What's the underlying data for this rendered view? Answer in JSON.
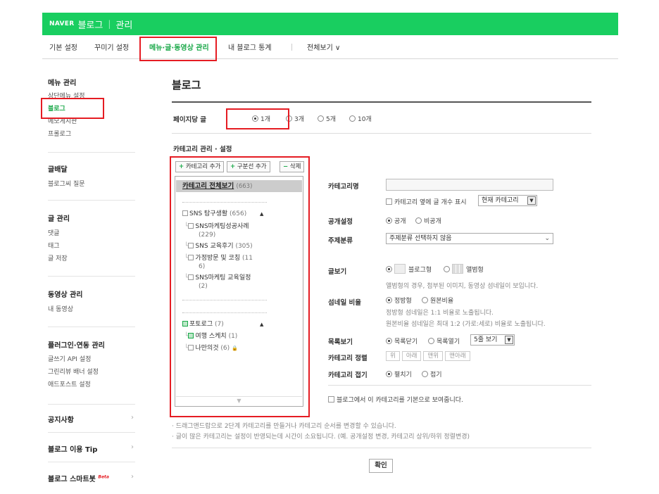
{
  "header": {
    "logo": "NAVER",
    "title": "블로그",
    "sep": "|",
    "section": "관리"
  },
  "nav": {
    "tabs": [
      "기본 설정",
      "꾸미기 설정",
      "메뉴·글·동영상 관리",
      "내 블로그 통계",
      "전체보기 ∨"
    ],
    "active": 2
  },
  "sidebar": {
    "sections": [
      {
        "title": "메뉴 관리",
        "items": [
          "상단메뉴 설정",
          "블로그",
          "메모게시판",
          "프롤로그"
        ]
      },
      {
        "title": "글배달",
        "items": [
          "블로그씨 질문"
        ]
      },
      {
        "title": "글 관리",
        "items": [
          "댓글",
          "태그",
          "글 저장"
        ]
      },
      {
        "title": "동영상 관리",
        "items": [
          "내 동영상"
        ]
      },
      {
        "title": "플러그인·연동 관리",
        "items": [
          "글쓰기 API 설정",
          "그린리뷰 배너 설정",
          "애드포스트 설정"
        ]
      }
    ],
    "links": [
      "공지사항",
      "블로그 이용 Tip",
      "블로그 스마트봇"
    ],
    "beta": "Beta",
    "arrow": "›"
  },
  "main": {
    "title": "블로그",
    "per_page": {
      "label": "페이지당 글",
      "options": [
        "1개",
        "3개",
        "5개",
        "10개"
      ],
      "selected": 0
    },
    "category_section_title": "카테고리 관리 · 설정",
    "buttons": {
      "add_category_icon": "+",
      "add_category": "카테고리 추가",
      "add_divider_icon": "+",
      "add_divider": "구분선 추가",
      "delete_icon": "−",
      "delete": "삭제"
    },
    "tree": {
      "root_label": "카테고리 전체보기",
      "root_count": "(663)",
      "nodes": [
        {
          "label": "SNS 탐구생활",
          "count": "(656)",
          "toggle": "▲"
        },
        {
          "label": "SNS마케팅성공사례",
          "count": "(229)"
        },
        {
          "label": "SNS 교육후기",
          "count": "(305)"
        },
        {
          "label": "가정방문 및 코칭",
          "count": "(11",
          "count2": "6)"
        },
        {
          "label": "SNS마케팅 교육일정",
          "count": "(2)"
        },
        {
          "label": "포토로그",
          "count": "(7)",
          "toggle": "▲"
        },
        {
          "label": "여행 스케치",
          "count": "(1)"
        },
        {
          "label": "나만의것",
          "count": "(6)",
          "lock": "🔒"
        }
      ],
      "branch": "└",
      "scroll": "▼"
    },
    "settings": {
      "name_label": "카테고리명",
      "name_value": "",
      "show_count_label": "카테고리 옆에 글 개수 표시",
      "show_count_select": "현재 카테고리",
      "visibility_label": "공개설정",
      "visibility_options": [
        "공개",
        "비공개"
      ],
      "topic_label": "주제분류",
      "topic_value": "주제분류 선택하지 않음",
      "view_label": "글보기",
      "view_options": [
        "블로그형",
        "앨범형"
      ],
      "view_hint": "앨범형의 경우, 첨부된 이미지, 동영상 섬네일이 보입니다.",
      "thumb_label": "섬네일 비율",
      "thumb_options": [
        "정방형",
        "원본비율"
      ],
      "thumb_hint1": "정방형 섬네일은 1:1 비율로 노출됩니다.",
      "thumb_hint2": "원본비율 섬네일은 최대 1:2 (가로:세로) 비율로 노출됩니다.",
      "list_label": "목록보기",
      "list_options": [
        "목록닫기",
        "목록열기"
      ],
      "list_select": "5줄 보기",
      "sort_label": "카테고리 정렬",
      "sort_buttons": [
        "위",
        "아래",
        "맨위",
        "맨아래"
      ],
      "fold_label": "카테고리 접기",
      "fold_options": [
        "펼치기",
        "접기"
      ],
      "default_label": "블로그에서 이 카테고리를 기본으로 보여줍니다."
    },
    "notes": [
      "· 드래그앤드랍으로 2단계 카테고리를 만들거나 카테고리 순서를 변경할 수 있습니다.",
      "· 글이 많은 카테고리는 설정이 반영되는데 시간이 소요됩니다. (예. 공개설정 변경, 카테고리 상위/하위 정렬변경)"
    ],
    "confirm": "확인"
  }
}
